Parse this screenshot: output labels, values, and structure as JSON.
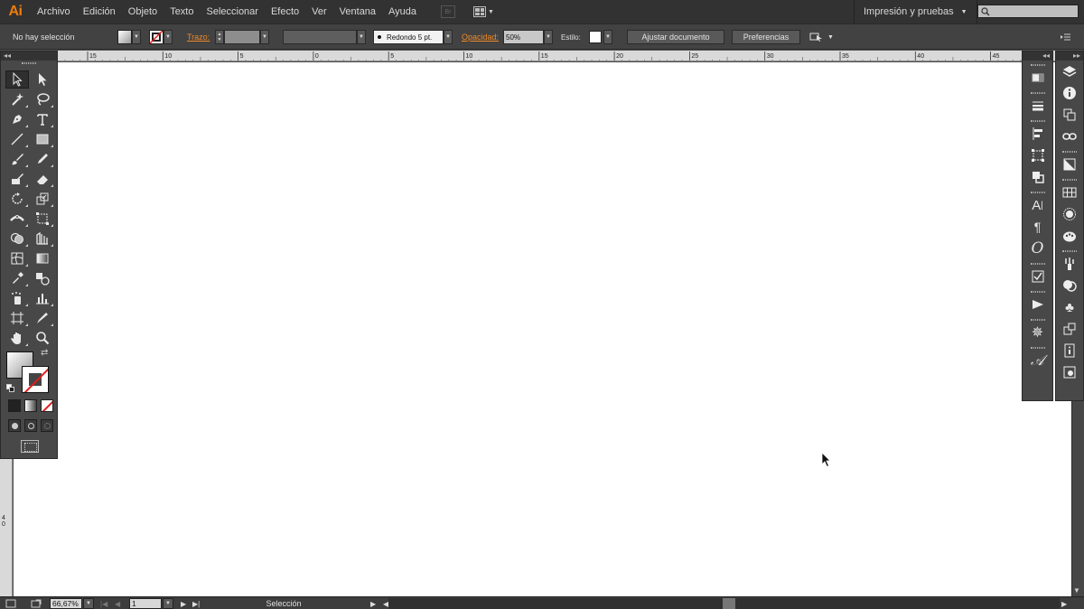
{
  "app": {
    "logo": "Ai",
    "menu": [
      "Archivo",
      "Edición",
      "Objeto",
      "Texto",
      "Seleccionar",
      "Efecto",
      "Ver",
      "Ventana",
      "Ayuda"
    ],
    "bridge_label": "Br",
    "workspace": "Impresión y pruebas"
  },
  "control_bar": {
    "selection": "No hay selección",
    "stroke_label": "Trazo:",
    "brush_label": "Redondo 5 pt.",
    "opacity_label": "Opacidad:",
    "opacity_value": "50%",
    "style_label": "Estilo:",
    "fit_document": "Ajustar documento",
    "preferences": "Preferencias"
  },
  "ruler": {
    "ticks": [
      "15",
      "10",
      "5",
      "0",
      "5",
      "10",
      "15",
      "20",
      "25",
      "30",
      "35",
      "40",
      "45"
    ],
    "left_tick": "40"
  },
  "status_bar": {
    "zoom": "66,67%",
    "page": "1",
    "selection": "Selección"
  },
  "colors": {
    "accent": "#f07d0a",
    "chrome_dark": "#323232",
    "panel": "#484848",
    "label_orange": "#f08a24",
    "stroke_none_red": "#e21c1c"
  },
  "tools": [
    [
      "selection-arrow-icon",
      "direct-selection-icon"
    ],
    [
      "magic-wand-icon",
      "lasso-icon"
    ],
    [
      "pen-icon",
      "type-icon"
    ],
    [
      "line-segment-icon",
      "rectangle-icon"
    ],
    [
      "paintbrush-icon",
      "pencil-icon"
    ],
    [
      "blob-brush-icon",
      "eraser-icon"
    ],
    [
      "rotate-icon",
      "scale-icon"
    ],
    [
      "width-icon",
      "free-transform-icon"
    ],
    [
      "shape-builder-icon",
      "perspective-grid-icon"
    ],
    [
      "mesh-icon",
      "gradient-icon"
    ],
    [
      "eyedropper-icon",
      "blend-icon"
    ],
    [
      "symbol-sprayer-icon",
      "column-graph-icon"
    ],
    [
      "artboard-icon",
      "slice-icon"
    ],
    [
      "hand-icon",
      "zoom-icon"
    ]
  ],
  "dock": {
    "col1": [
      "gradient-panel-icon",
      "stroke-panel-icon",
      "align-panel-icon",
      "transform-panel-icon",
      "pathfinder-panel-icon",
      "character-panel-icon",
      "paragraph-panel-icon",
      "opentype-panel-icon",
      "attributes-panel-icon",
      "actions-panel-icon",
      "navigator-panel-icon",
      "glyphs-panel-icon"
    ],
    "col2": [
      "layers-panel-icon",
      "info-panel-icon",
      "artboards-panel-icon",
      "links-panel-icon",
      "transparency-panel-icon",
      "swatches-panel-icon",
      "appearance-panel-icon",
      "color-guide-panel-icon",
      "brushes-panel-icon",
      "graphic-styles-panel-icon",
      "symbols-panel-icon",
      "asset-export-panel-icon",
      "document-info-panel-icon",
      "libraries-panel-icon"
    ]
  }
}
